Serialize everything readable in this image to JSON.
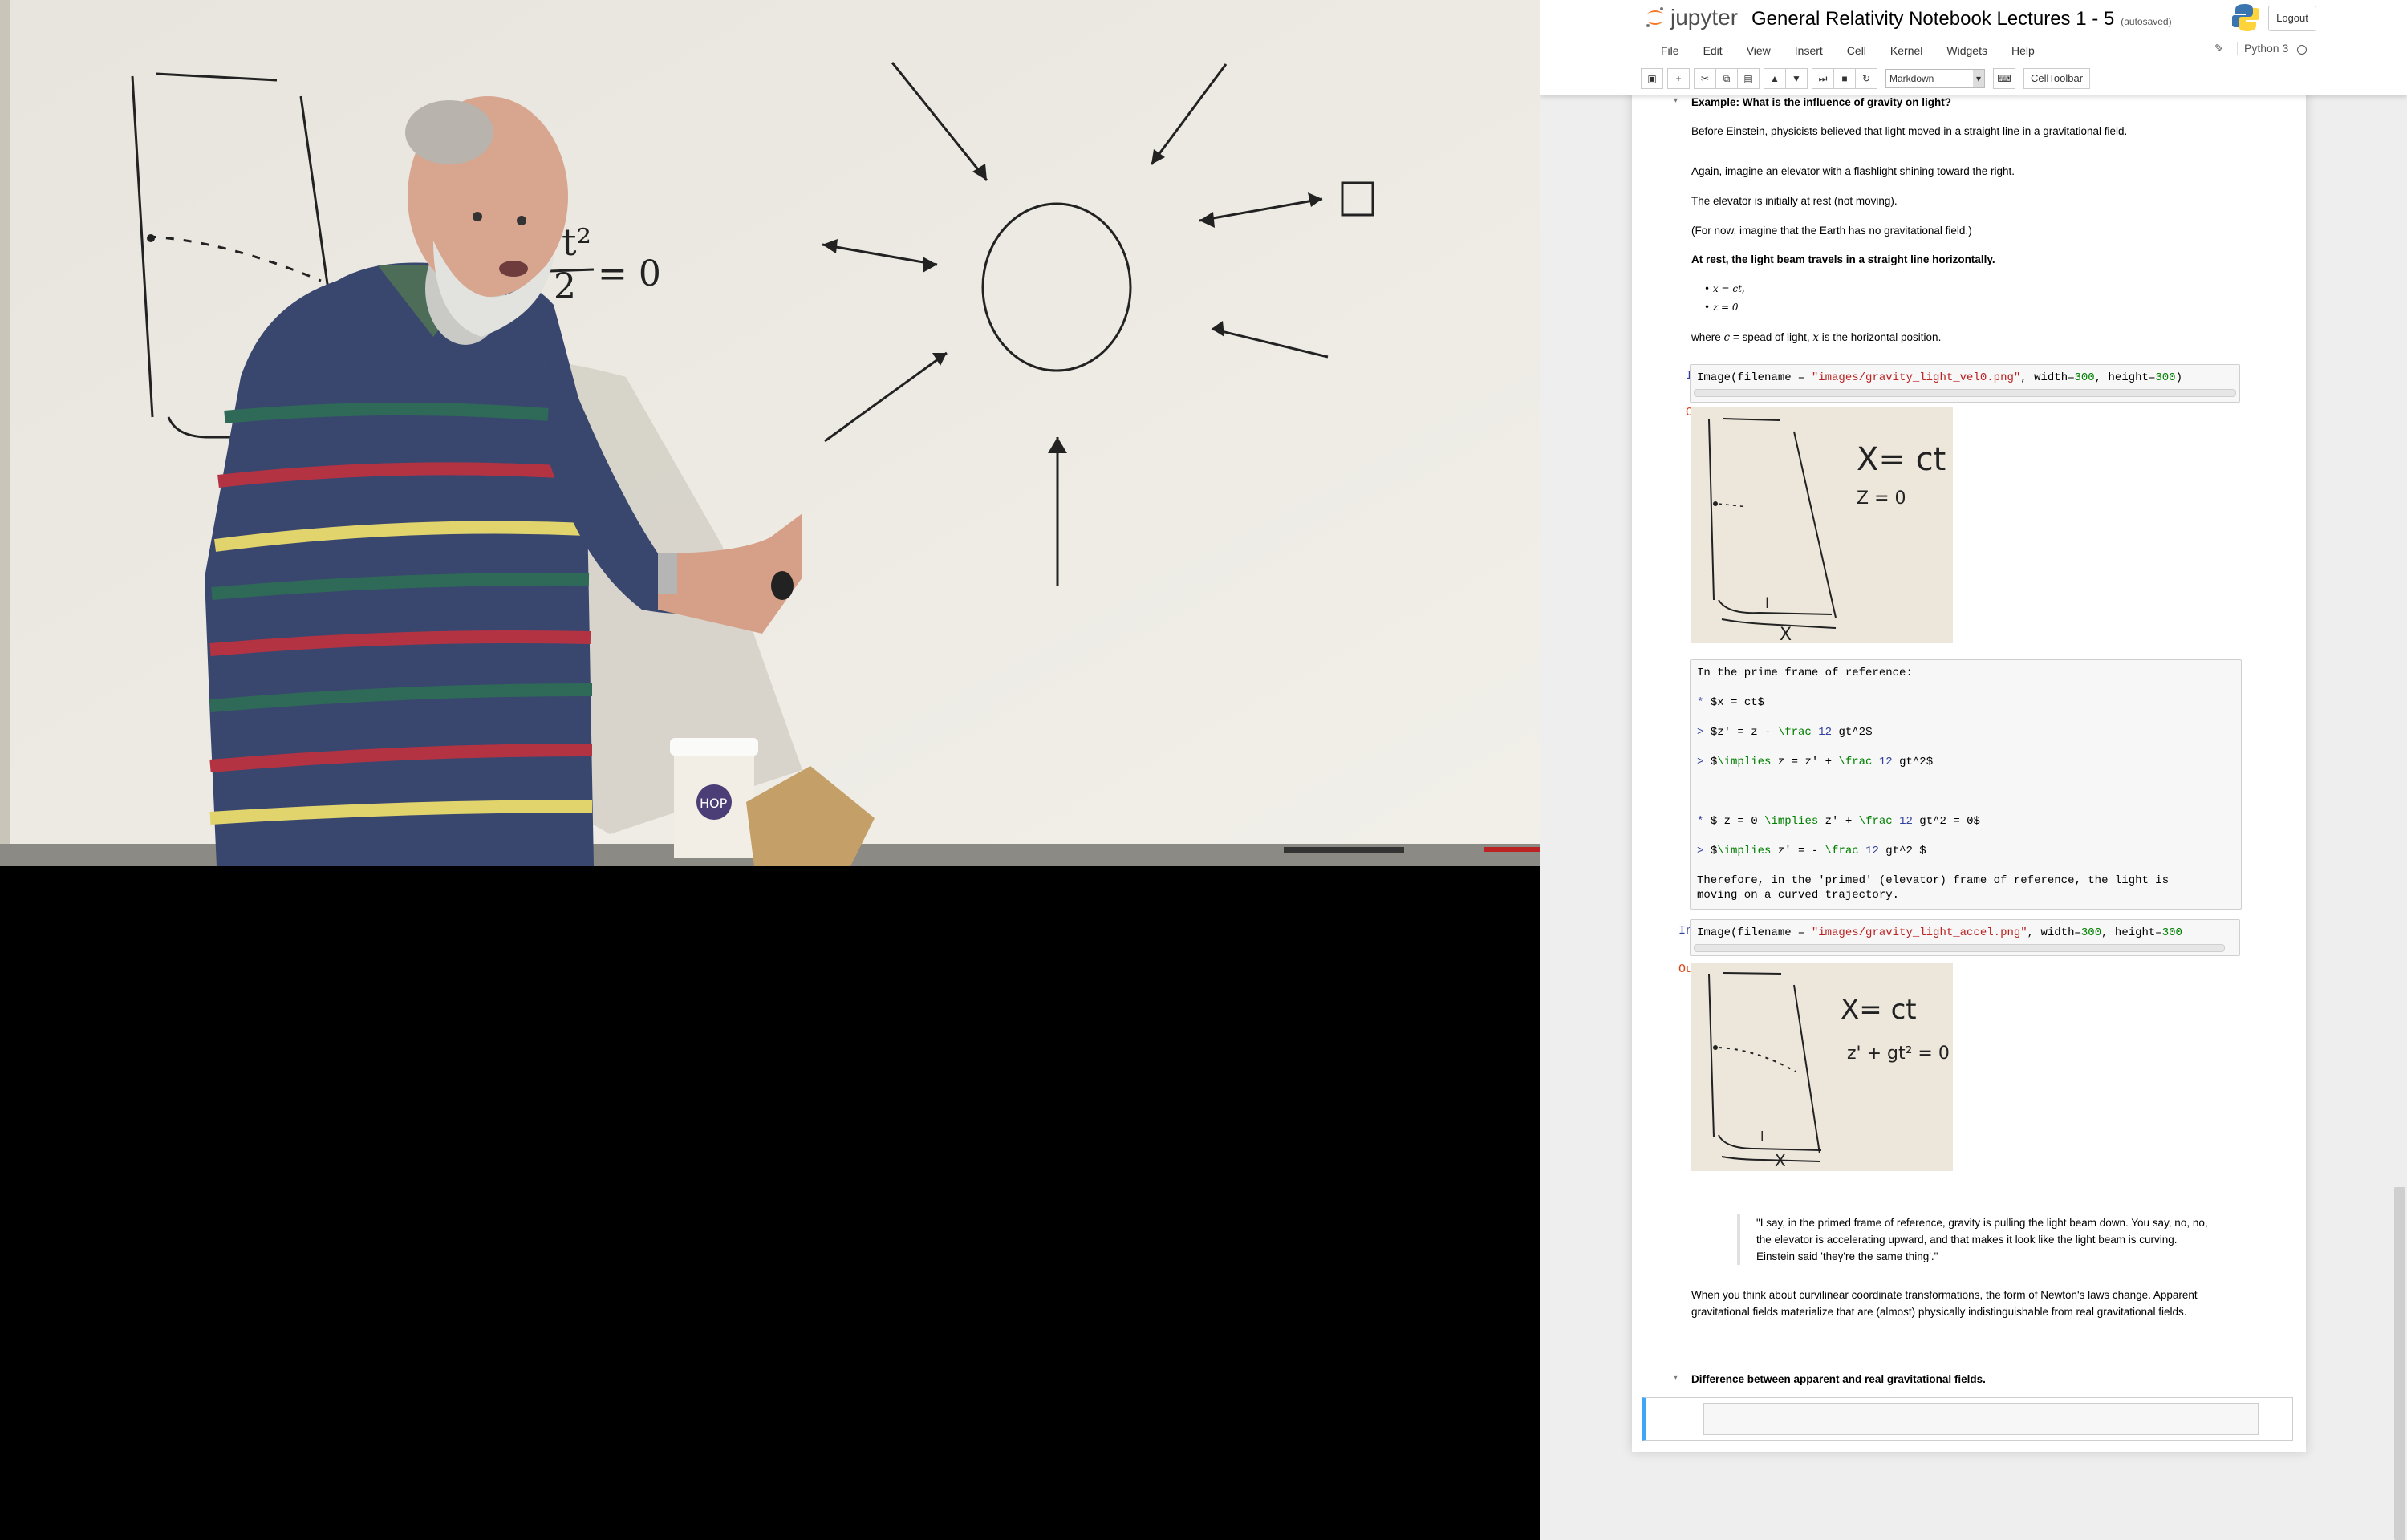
{
  "header": {
    "logo_text": "jupyter",
    "notebook_title": "General Relativity Notebook Lectures 1 - 5",
    "save_status": "(autosaved)",
    "logout_label": "Logout",
    "kernel_name": "Python 3"
  },
  "menu": [
    "File",
    "Edit",
    "View",
    "Insert",
    "Cell",
    "Kernel",
    "Widgets",
    "Help"
  ],
  "toolbar": {
    "cell_type": "Markdown",
    "celltoolbar_label": "CellToolbar"
  },
  "notebook": {
    "section_heading": "Example: What is the influence of gravity on light?",
    "p1": "Before Einstein, physicists believed that light moved in a straight line in a gravitational field.",
    "p2": "Again, imagine an elevator with a flashlight shining toward the right.",
    "p3": "The elevator is initially at rest (not moving).",
    "p4": "(For now, imagine that the Earth has no gravitational field.)",
    "rest_heading": "At rest, the light beam travels in a straight line horizontally.",
    "bullet1": "x = ct,",
    "bullet2": "z = 0",
    "where_prefix": "where",
    "where_c": "c",
    "where_mid": "= spead of light,",
    "where_x": "x",
    "where_suffix": "is the horizontal position.",
    "in9_prompt": "In [9]:",
    "in9_code": {
      "a": "Image(filename = ",
      "b": "\"images/gravity_light_vel0.png\"",
      "c": ", width=",
      "d": "300",
      "e": ", height=",
      "f": "300",
      "g": ")"
    },
    "out9_prompt": "Out[9]:",
    "img1_text": {
      "eq1": "X= ct",
      "eq2": "Z = 0",
      "l": "l",
      "x": "X"
    },
    "raw_lines": {
      "l1": "In the prime frame of reference:",
      "l2a": "* ",
      "l2b": "$x = ct$",
      "l3a": "> ",
      "l3b": "$z' = z - ",
      "l3c": "\\frac",
      "l3d": " ",
      "l3e": "12",
      "l3f": " gt^2$",
      "l4a": "> ",
      "l4b": "$",
      "l4c": "\\implies",
      "l4d": " z = z' + ",
      "l4e": "\\frac",
      "l4f": " ",
      "l4g": "12",
      "l4h": " gt^2$",
      "l5a": "* ",
      "l5b": "$ z = 0 ",
      "l5c": "\\implies",
      "l5d": " z' + ",
      "l5e": "\\frac",
      "l5f": " ",
      "l5g": "12",
      "l5h": " gt^2 = 0$",
      "l6a": "> ",
      "l6b": "$",
      "l6c": "\\implies",
      "l6d": " z' = - ",
      "l6e": "\\frac",
      "l6f": " ",
      "l6g": "12",
      "l6h": " gt^2 $",
      "l7": "Therefore, in the 'primed' (elevator) frame of reference, the light is",
      "l8": "moving on a curved trajectory."
    },
    "in10_prompt": "In [10]:",
    "in10_code": {
      "a": "Image(filename = ",
      "b": "\"images/gravity_light_accel.png\"",
      "c": ", width=",
      "d": "300",
      "e": ", height=",
      "f": "300"
    },
    "out10_prompt": "Out[10]:",
    "img2_text": {
      "eq1": "X= ct",
      "eq2": "z' + gt² = 0",
      "l": "l",
      "x": "X"
    },
    "quote": "\"I say, in the primed frame of reference, gravity is pulling the light beam down. You say, no, no, the elevator is accelerating upward, and that makes it look like the light beam is curving. Einstein said 'they're the same thing'.\"",
    "p5": "When you think about curvilinear coordinate transformations, the form of Newton's laws change. Apparent gravitational fields materialize that are (almost) physically indistinguishable from real gravitational fields.",
    "heading2": "Difference between apparent and real gravitational fields."
  },
  "whiteboard": {
    "eq_frac_top": "t²",
    "eq_frac_bottom": "2",
    "eq_rest": "= 0",
    "cup_logo": "HOP"
  },
  "colors": {
    "whiteboard": "#efede6",
    "video_bg": "#000000",
    "prompt_in": "#303f9f",
    "prompt_out": "#d84315",
    "selected_cell": "#42a5f5"
  }
}
